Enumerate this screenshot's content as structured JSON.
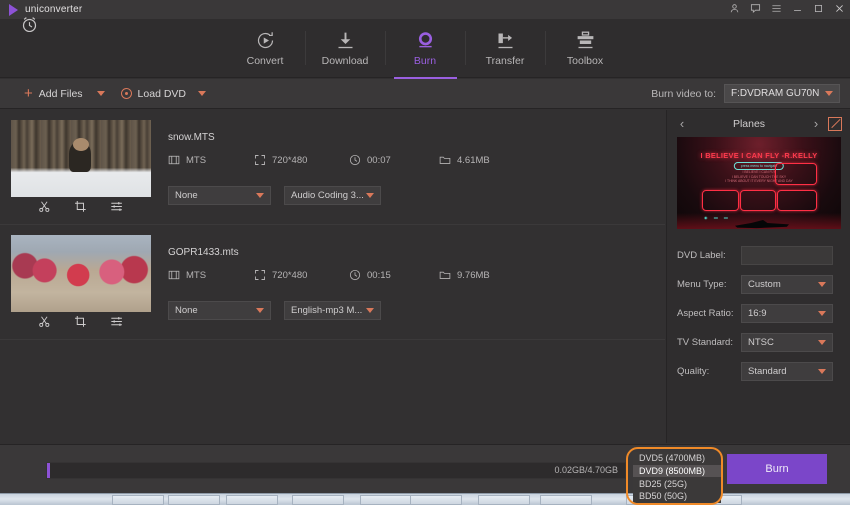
{
  "titlebar": {
    "app_name": "uniconverter",
    "logo_icon": "play-triangle-icon",
    "controls": [
      {
        "name": "account-icon",
        "glyph": "⛉"
      },
      {
        "name": "feedback-icon",
        "glyph": "⬜"
      },
      {
        "name": "menu-icon",
        "glyph": "≡"
      },
      {
        "name": "minimize-icon",
        "glyph": "—"
      },
      {
        "name": "maximize-icon",
        "glyph": "☐"
      },
      {
        "name": "close-icon",
        "glyph": "✕"
      }
    ]
  },
  "nav": {
    "tabs": [
      {
        "label": "Convert",
        "icon": "convert-circular-arrow-icon",
        "active": false
      },
      {
        "label": "Download",
        "icon": "download-arrow-icon",
        "active": false
      },
      {
        "label": "Burn",
        "icon": "burn-disc-icon",
        "active": true
      },
      {
        "label": "Transfer",
        "icon": "transfer-device-icon",
        "active": false
      },
      {
        "label": "Toolbox",
        "icon": "toolbox-icon",
        "active": false
      }
    ]
  },
  "toolbar": {
    "add_files_label": "Add Files",
    "load_dvd_label": "Load DVD",
    "burn_video_to_label": "Burn video to:",
    "burn_target_value": "F:DVDRAM GU70N"
  },
  "files": [
    {
      "name": "snow.MTS",
      "format": "MTS",
      "resolution": "720*480",
      "duration": "00:07",
      "size": "4.61MB",
      "subtitle_select": "None",
      "audio_select": "Audio Coding 3...",
      "thumb_class": "pic-snow"
    },
    {
      "name": "GOPR1433.mts",
      "format": "MTS",
      "resolution": "720*480",
      "duration": "00:15",
      "size": "9.76MB",
      "subtitle_select": "None",
      "audio_select": "English-mp3 M...",
      "thumb_class": "pic-crowd"
    }
  ],
  "item_actions": [
    {
      "name": "trim-scissors-icon"
    },
    {
      "name": "crop-icon"
    },
    {
      "name": "effects-sliders-icon"
    }
  ],
  "right_panel": {
    "template_name": "Planes",
    "prev_icon": "chevron-left-icon",
    "next_icon": "chevron-right-icon",
    "edit_icon": "edit-pencil-icon",
    "preview": {
      "title": "I BELIEVE I CAN FLY -R.KELLY",
      "badge": "press menu to navigate",
      "lines": "I BELIEVE I CAN FLY\nI BELIEVE I CAN TOUCH THE SKY\nI THINK ABOUT IT EVERY NIGHT AND DAY"
    },
    "fields": [
      {
        "label": "DVD Label:",
        "type": "input",
        "value": "",
        "name": "dvd-label-input"
      },
      {
        "label": "Menu Type:",
        "type": "select",
        "value": "Custom",
        "name": "menu-type-select"
      },
      {
        "label": "Aspect Ratio:",
        "type": "select",
        "value": "16:9",
        "name": "aspect-ratio-select"
      },
      {
        "label": "TV Standard:",
        "type": "select",
        "value": "NTSC",
        "name": "tv-standard-select"
      },
      {
        "label": "Quality:",
        "type": "select",
        "value": "Standard",
        "name": "quality-select"
      }
    ]
  },
  "bottom": {
    "timer_icon": "alarm-clock-icon",
    "capacity_text": "0.02GB/4.70GB",
    "progress_percent": 0.4,
    "burn_button_label": "Burn",
    "disc_size_options": [
      {
        "label": "DVD5 (4700MB)",
        "selected": false
      },
      {
        "label": "DVD9 (8500MB)",
        "selected": true
      },
      {
        "label": "BD25 (25G)",
        "selected": false
      },
      {
        "label": "BD50 (50G)",
        "selected": false
      }
    ]
  },
  "colors": {
    "accent_purple": "#8d52d6",
    "accent_orange": "#d9785a",
    "highlight_orange": "#f08a28",
    "window_bg": "#323031"
  }
}
